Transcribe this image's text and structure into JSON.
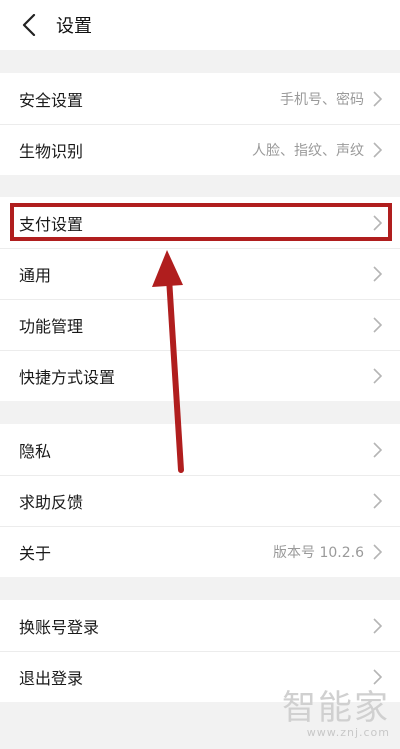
{
  "header": {
    "title": "设置"
  },
  "groups": [
    {
      "items": [
        {
          "label": "安全设置",
          "value": "手机号、密码"
        },
        {
          "label": "生物识别",
          "value": "人脸、指纹、声纹"
        }
      ]
    },
    {
      "items": [
        {
          "label": "支付设置",
          "value": ""
        },
        {
          "label": "通用",
          "value": ""
        },
        {
          "label": "功能管理",
          "value": ""
        },
        {
          "label": "快捷方式设置",
          "value": ""
        }
      ]
    },
    {
      "items": [
        {
          "label": "隐私",
          "value": ""
        },
        {
          "label": "求助反馈",
          "value": ""
        },
        {
          "label": "关于",
          "value": "版本号 10.2.6"
        }
      ]
    },
    {
      "items": [
        {
          "label": "换账号登录",
          "value": ""
        },
        {
          "label": "退出登录",
          "value": ""
        }
      ]
    }
  ],
  "annotation": {
    "color": "#b01e1e"
  },
  "watermark": {
    "logo": "智能家",
    "site": "www.znj.com"
  }
}
